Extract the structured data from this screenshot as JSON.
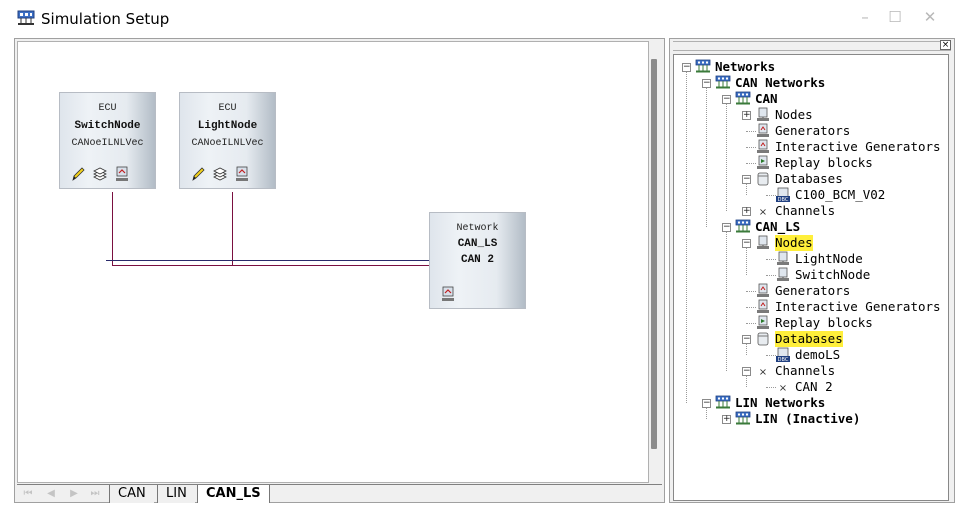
{
  "window": {
    "title": "Simulation Setup",
    "minimize": "–",
    "maximize": "☐",
    "close": "✕"
  },
  "canvas": {
    "nodes": [
      {
        "type": "ECU",
        "name": "SwitchNode",
        "db": "CANoeILNLVec"
      },
      {
        "type": "ECU",
        "name": "LightNode",
        "db": "CANoeILNLVec"
      }
    ],
    "network": {
      "type": "Network",
      "name": "CAN_LS",
      "channel": "CAN 2"
    }
  },
  "tabs": {
    "nav": [
      "⏮",
      "◀",
      "▶",
      "⏭"
    ],
    "items": [
      {
        "label": "CAN",
        "active": false
      },
      {
        "label": "LIN",
        "active": false
      },
      {
        "label": "CAN_LS",
        "active": true
      }
    ]
  },
  "tree": {
    "close": "×",
    "rows": [
      {
        "label": "Networks",
        "bold": true,
        "icon": "network-icon",
        "expander": "−",
        "highlight": false
      },
      {
        "label": "CAN Networks",
        "bold": true,
        "icon": "network-icon",
        "expander": "−",
        "highlight": false
      },
      {
        "label": "CAN",
        "bold": true,
        "icon": "network-icon",
        "expander": "−",
        "highlight": false
      },
      {
        "label": "Nodes",
        "bold": false,
        "icon": "node-icon",
        "expander": "+",
        "highlight": false
      },
      {
        "label": "Generators",
        "bold": false,
        "icon": "generator-icon",
        "expander": "",
        "highlight": false
      },
      {
        "label": "Interactive Generators",
        "bold": false,
        "icon": "generator-icon",
        "expander": "",
        "highlight": false
      },
      {
        "label": "Replay blocks",
        "bold": false,
        "icon": "replay-icon",
        "expander": "",
        "highlight": false
      },
      {
        "label": "Databases",
        "bold": false,
        "icon": "database-icon",
        "expander": "−",
        "highlight": false
      },
      {
        "label": "C100_BCM_V02",
        "bold": false,
        "icon": "dbc-file-icon",
        "expander": "",
        "highlight": false
      },
      {
        "label": "Channels",
        "bold": false,
        "icon": "channel-icon",
        "expander": "+",
        "highlight": false
      },
      {
        "label": "CAN_LS",
        "bold": true,
        "icon": "network-icon",
        "expander": "−",
        "highlight": false
      },
      {
        "label": "Nodes",
        "bold": false,
        "icon": "node-icon",
        "expander": "−",
        "highlight": true
      },
      {
        "label": "LightNode",
        "bold": false,
        "icon": "node-icon",
        "expander": "",
        "highlight": false
      },
      {
        "label": "SwitchNode",
        "bold": false,
        "icon": "node-icon",
        "expander": "",
        "highlight": false
      },
      {
        "label": "Generators",
        "bold": false,
        "icon": "generator-icon",
        "expander": "",
        "highlight": false
      },
      {
        "label": "Interactive Generators",
        "bold": false,
        "icon": "generator-icon",
        "expander": "",
        "highlight": false
      },
      {
        "label": "Replay blocks",
        "bold": false,
        "icon": "replay-icon",
        "expander": "",
        "highlight": false
      },
      {
        "label": "Databases",
        "bold": false,
        "icon": "database-icon",
        "expander": "−",
        "highlight": true
      },
      {
        "label": "demoLS",
        "bold": false,
        "icon": "dbc-file-icon",
        "expander": "",
        "highlight": false
      },
      {
        "label": "Channels",
        "bold": false,
        "icon": "channel-icon",
        "expander": "−",
        "highlight": false
      },
      {
        "label": "CAN 2",
        "bold": false,
        "icon": "channel-icon",
        "expander": "",
        "highlight": false
      },
      {
        "label": "LIN Networks",
        "bold": true,
        "icon": "network-icon",
        "expander": "−",
        "highlight": false
      },
      {
        "label": "LIN (Inactive)",
        "bold": true,
        "icon": "network-icon",
        "expander": "+",
        "highlight": false
      }
    ]
  }
}
